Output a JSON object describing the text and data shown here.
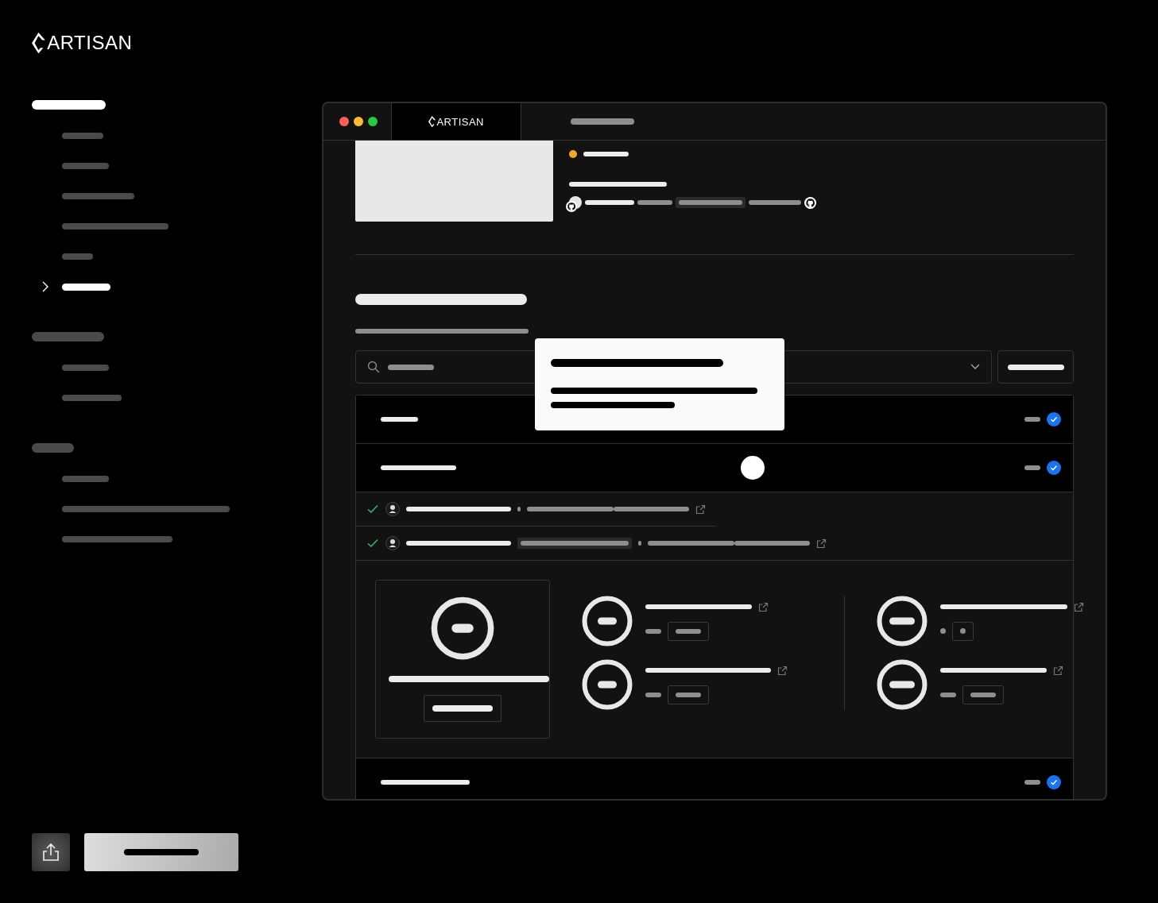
{
  "brand": {
    "name": "ARTISAN"
  },
  "sidebar": {
    "groups": [
      {
        "active": true,
        "items": [
          {
            "selected": false
          },
          {
            "selected": false
          },
          {
            "selected": false
          },
          {
            "selected": false
          },
          {
            "selected": false
          },
          {
            "selected": true
          }
        ]
      },
      {
        "active": false,
        "items": [
          {
            "selected": false
          },
          {
            "selected": false
          }
        ]
      },
      {
        "active": false,
        "items": [
          {
            "selected": false
          },
          {
            "selected": false
          },
          {
            "selected": false
          }
        ]
      }
    ]
  },
  "footer_actions": [
    {
      "kind": "share"
    },
    {
      "kind": "primary"
    }
  ],
  "window": {
    "traffic_lights": [
      {
        "color": "#ff5f57"
      },
      {
        "color": "#febc2e"
      },
      {
        "color": "#28c840"
      }
    ],
    "tabs": [
      {
        "kind": "logo",
        "label": "ARTISAN",
        "selected": true
      },
      {
        "kind": "placeholder",
        "selected": false
      }
    ],
    "project": {
      "status_dot": {
        "color": "#f5a623"
      }
    },
    "tooltip": {
      "visible": true
    },
    "checks": [
      {
        "checked": true,
        "expanded": false
      },
      {
        "checked": true,
        "expanded": true,
        "steps": [
          {
            "passed": true,
            "kind": "plain"
          },
          {
            "passed": true,
            "kind": "tagged"
          }
        ],
        "metrics": [
          {
            "kind": "chip"
          },
          {
            "kind": "dot"
          },
          {
            "kind": "chip"
          },
          {
            "kind": "chip"
          }
        ]
      },
      {
        "checked": true,
        "expanded": false
      }
    ]
  }
}
